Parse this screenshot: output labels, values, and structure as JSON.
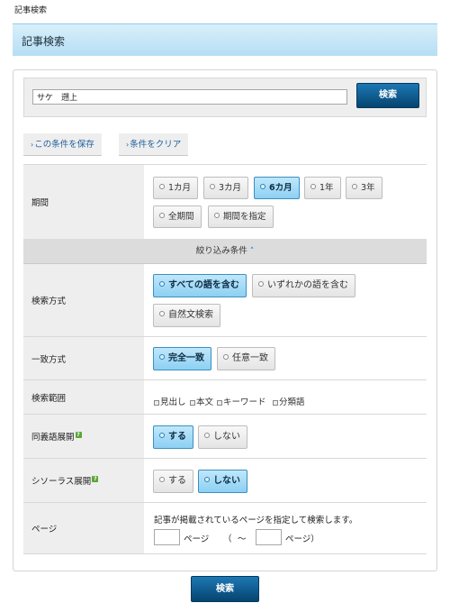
{
  "breadcrumb": "記事検索",
  "page_title": "記事検索",
  "search": {
    "value": "サケ　遡上",
    "button": "検索"
  },
  "links": {
    "save": "この条件を保存",
    "clear": "条件をクリア"
  },
  "period": {
    "label": "期間",
    "options": [
      "1カ月",
      "3カ月",
      "6カ月",
      "1年",
      "3年",
      "全期間",
      "期間を指定"
    ],
    "selected": "6カ月"
  },
  "narrow_toggle": "絞り込み条件",
  "search_method": {
    "label": "検索方式",
    "options": [
      "すべての語を含む",
      "いずれかの語を含む",
      "自然文検索"
    ],
    "selected": "すべての語を含む"
  },
  "match_method": {
    "label": "一致方式",
    "options": [
      "完全一致",
      "任意一致"
    ],
    "selected": "完全一致"
  },
  "scope": {
    "label": "検索範囲",
    "options": [
      "見出し",
      "本文",
      "キーワード",
      "分類語"
    ]
  },
  "synonym": {
    "label": "同義語展開",
    "options": [
      "する",
      "しない"
    ],
    "selected": "する"
  },
  "thesaurus": {
    "label": "シソーラス展開",
    "options": [
      "する",
      "しない"
    ],
    "selected": "しない"
  },
  "page": {
    "label": "ページ",
    "instruction": "記事が掲載されているページを指定して検索します。",
    "unit": "ページ",
    "open": "（",
    "tilde": "～",
    "close": "ページ）"
  },
  "bottom_button": "検索",
  "colors": {
    "accent": "#0a5a92",
    "selected": "#8dd0f3",
    "help_icon": "#5aa636"
  }
}
